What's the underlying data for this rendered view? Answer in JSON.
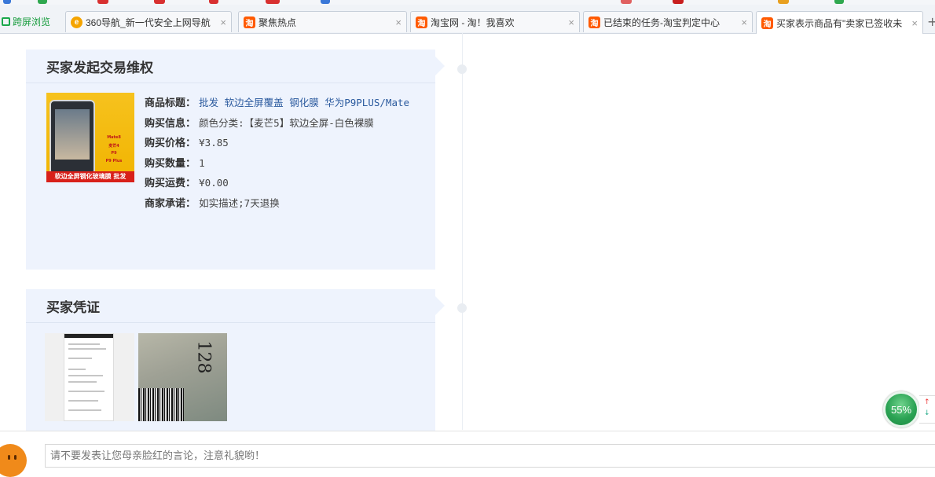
{
  "browser": {
    "kuaping_label": "跨屏浏览",
    "tabs": [
      {
        "title": "360导航_新一代安全上网导航",
        "close": "×",
        "icon": "360-logo-icon"
      },
      {
        "title": "聚焦热点",
        "close": "×",
        "icon": "taobao-icon"
      },
      {
        "title": "淘宝网 - 淘！我喜欢",
        "close": "×",
        "icon": "taobao-icon"
      },
      {
        "title": "已结束的任务-淘宝判定中心",
        "close": "×",
        "icon": "taobao-icon"
      },
      {
        "title": "买家表示商品有\"卖家已签收未",
        "close": "×",
        "icon": "taobao-icon",
        "active": true
      }
    ],
    "new_tab": "+"
  },
  "dispute": {
    "title": "买家发起交易维权",
    "product": {
      "badge": "软边全屏钢化玻璃膜 批发",
      "image_text": [
        "Mate8",
        "麦芒4",
        "P9",
        "P9 Plus"
      ],
      "fields": [
        {
          "label": "商品标题：",
          "value": "批发 软边全屏覆盖 钢化膜 华为P9PLUS/Mate",
          "link": true
        },
        {
          "label": "购买信息：",
          "value": "颜色分类:【麦芒5】软边全屏-白色裸膜"
        },
        {
          "label": "购买价格：",
          "value": "¥3.85"
        },
        {
          "label": "购买数量：",
          "value": "1"
        },
        {
          "label": "购买运费：",
          "value": "¥0.00"
        },
        {
          "label": "商家承诺：",
          "value": "如实描述;7天退换"
        }
      ]
    }
  },
  "evidence": {
    "title": "买家凭证",
    "handwriting": "128"
  },
  "speed_badge": {
    "value": "55%",
    "up": "↑",
    "down": "↓"
  },
  "comment": {
    "placeholder": "请不要发表让您母亲脸红的言论，注意礼貌哟！"
  }
}
